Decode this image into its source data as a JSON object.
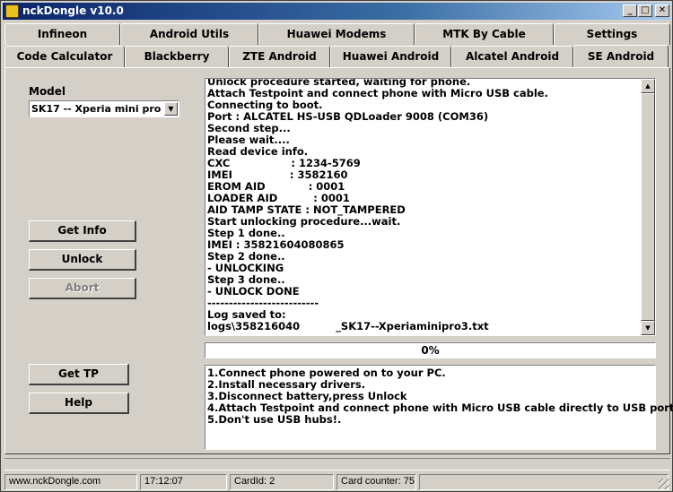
{
  "window": {
    "title": "nckDongle v10.0"
  },
  "titlebar_buttons": {
    "minimize": "_",
    "maximize": "□",
    "close": "✕"
  },
  "tabs_row1": [
    "Infineon",
    "Android Utils",
    "Huawei Modems",
    "MTK By Cable",
    "Settings"
  ],
  "tabs_row2": [
    "Code Calculator",
    "Blackberry",
    "ZTE Android",
    "Huawei Android",
    "Alcatel Android",
    "SE Android"
  ],
  "active_tab": "SE Android",
  "model": {
    "label": "Model",
    "selected": "SK17 -- Xperia mini pro"
  },
  "buttons": {
    "get_info": "Get Info",
    "unlock": "Unlock",
    "abort": "Abort",
    "get_tp": "Get TP",
    "help": "Help"
  },
  "log_lines": [
    "Unlock procedure started, waiting for phone.",
    "Attach Testpoint and connect phone with Micro USB cable.",
    "Connecting to boot.",
    "Port : ALCATEL HS-USB QDLoader 9008 (COM36)",
    "Second step...",
    "Please wait....",
    "Read device info.",
    "CXC                 : 1234-5769",
    "IMEI                : 3582160",
    "EROM AID            : 0001",
    "LOADER AID          : 0001",
    "AID TAMP STATE : NOT_TAMPERED",
    "Start unlocking procedure...wait.",
    "Step 1 done..",
    "IMEI : 35821604080865",
    "Step 2 done..",
    "- UNLOCKING",
    "Step 3 done..",
    "- UNLOCK DONE",
    "--------------------------",
    "Log saved to:",
    "logs\\358216040          _SK17--Xperiaminipro3.txt"
  ],
  "progress": {
    "percent": 0,
    "label": "0%"
  },
  "help_lines": [
    "1.Connect phone powered on to your PC.",
    "2.Install necessary drivers.",
    "3.Disconnect battery,press Unlock",
    "4.Attach Testpoint and connect phone with Micro USB cable directly to USB port.",
    "5.Don't use USB hubs!."
  ],
  "status": {
    "website": "www.nckDongle.com",
    "time": "17:12:07",
    "card_id": "CardId: 2",
    "card_counter": "Card counter: 75"
  }
}
